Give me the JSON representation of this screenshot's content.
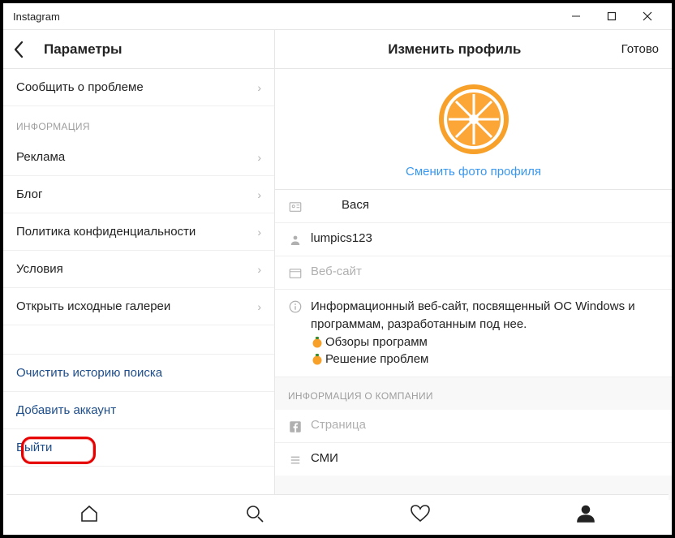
{
  "window": {
    "title": "Instagram"
  },
  "sidebar": {
    "header": "Параметры",
    "report_problem": "Сообщить о проблеме",
    "section_info": "ИНФОРМАЦИЯ",
    "items": {
      "ads": "Реклама",
      "blog": "Блог",
      "privacy": "Политика конфиденциальности",
      "terms": "Условия",
      "open_source": "Открыть исходные галереи"
    },
    "clear_search": "Очистить историю поиска",
    "add_account": "Добавить аккаунт",
    "logout": "Выйти"
  },
  "main": {
    "title": "Изменить профиль",
    "done": "Готово",
    "change_photo": "Сменить фото профиля",
    "name": "Вася",
    "username": "lumpics123",
    "website_placeholder": "Веб-сайт",
    "bio_line1": "Информационный веб-сайт, посвященный ОС Windows и программам, разработанным под нее.",
    "bio_line2": "Обзоры программ",
    "bio_line3": "Решение проблем",
    "company_section": "ИНФОРМАЦИЯ О КОМПАНИИ",
    "page_placeholder": "Страница",
    "media_label": "СМИ"
  }
}
